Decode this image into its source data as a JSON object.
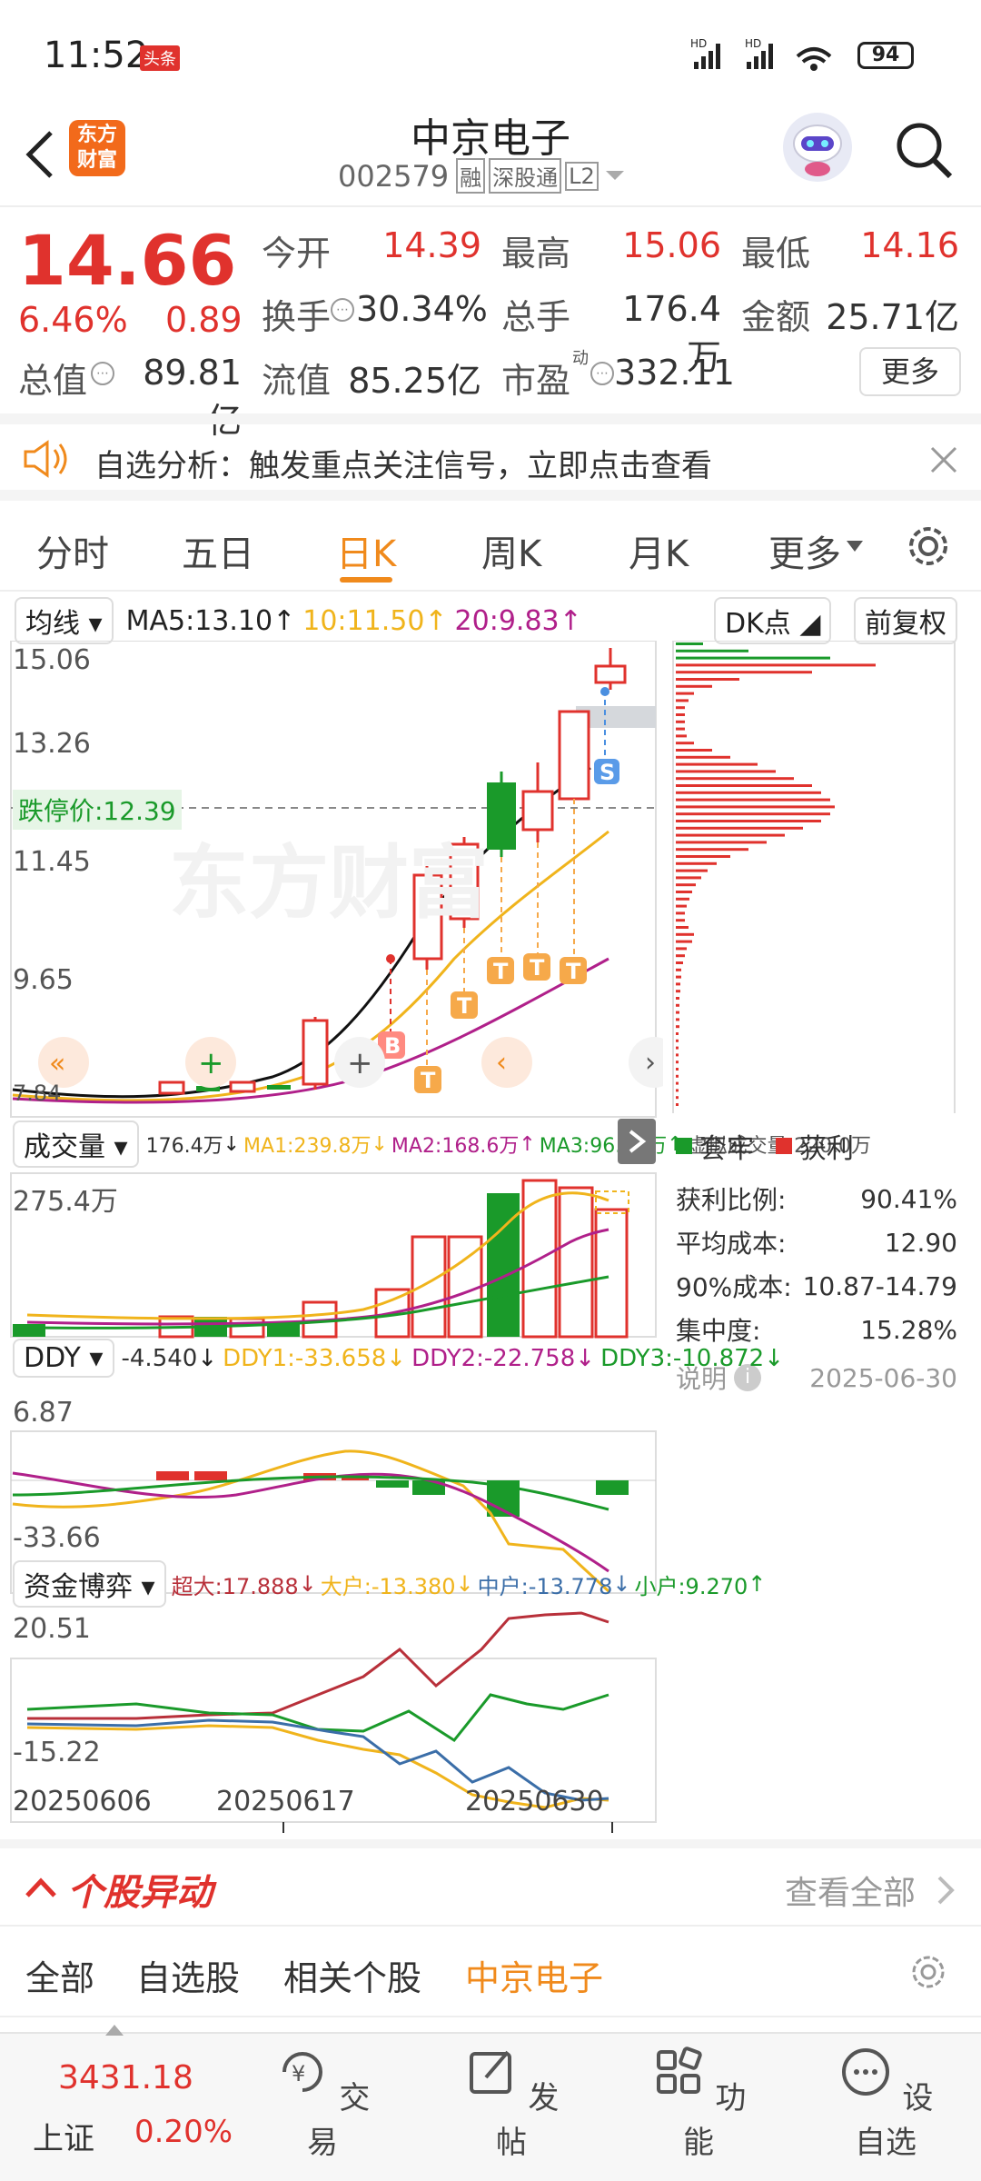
{
  "status_bar": {
    "time": "11:52",
    "app_badge": "头条",
    "battery": "94",
    "signal1": "HD",
    "signal2": "HD"
  },
  "header": {
    "title": "中京电子",
    "code": "002579",
    "tags": [
      "融",
      "深股通",
      "L2"
    ],
    "logo_text": "东方\n财富"
  },
  "quote": {
    "price": "14.66",
    "change_pct": "6.46%",
    "change": "0.89",
    "open_label": "今开",
    "open": "14.39",
    "high_label": "最高",
    "high": "15.06",
    "low_label": "最低",
    "low": "14.16",
    "turnover_label": "换手",
    "turnover": "30.34%",
    "volume_label": "总手",
    "volume": "176.4万",
    "amount_label": "金额",
    "amount": "25.71亿",
    "mcap_label": "总值",
    "mcap": "89.81亿",
    "float_label": "流值",
    "float": "85.25亿",
    "pe_label": "市盈",
    "pe_sup": "动",
    "pe": "332.11",
    "more_button": "更多"
  },
  "notice": {
    "text": "自选分析：触发重点关注信号，立即点击查看"
  },
  "tabs": [
    "分时",
    "五日",
    "日K",
    "周K",
    "月K",
    "更多"
  ],
  "active_tab": "日K",
  "kline": {
    "indicator_select": "均线",
    "ma5": "MA5:13.10",
    "ma10": "10:11.50",
    "ma20": "20:9.83",
    "dk_button": "DK点",
    "adjust_button": "前复权",
    "y_labels": [
      "15.06",
      "13.26",
      "11.45",
      "9.65",
      "7.84"
    ],
    "limit_label": "跌停价:12.39",
    "watermark": "东方财富",
    "markers": {
      "buy": "B",
      "sell": "S",
      "t": "T"
    }
  },
  "volume": {
    "select": "成交量",
    "summary": "176.4万",
    "ma1": "MA1:239.8万",
    "ma2": "MA2:168.6万",
    "ma3": "MA3:96.91万",
    "virtual": "虚拟成交量:220.0万",
    "y_label": "275.4万"
  },
  "ddy": {
    "select": "DDY",
    "value": "-4.540",
    "ddy1": "DDY1:-33.658",
    "ddy2": "DDY2:-22.758",
    "ddy3": "DDY3:-10.872",
    "y_top": "6.87",
    "y_bottom": "-33.66"
  },
  "fund": {
    "select": "资金博弈",
    "super": "超大:17.888",
    "big": "大户:-13.380",
    "mid": "中户:-13.778",
    "small": "小户:9.270",
    "y_top": "20.51",
    "y_bottom": "-15.22"
  },
  "dates": [
    "20250606",
    "20250617",
    "20250630"
  ],
  "chip": {
    "legend_trapped": "套牢",
    "legend_profit": "获利",
    "rows": [
      {
        "label": "获利比例:",
        "value": "90.41%"
      },
      {
        "label": "平均成本:",
        "value": "12.90"
      },
      {
        "label": "90%成本:",
        "value": "10.87-14.79"
      },
      {
        "label": "集中度:",
        "value": "15.28%"
      }
    ],
    "note_label": "说明",
    "note_date": "2025-06-30"
  },
  "movement": {
    "title": "个股异动",
    "view_all": "查看全部",
    "tabs": [
      "全部",
      "自选股",
      "相关个股",
      "中京电子"
    ],
    "active": "中京电子"
  },
  "bottom_nav": {
    "index_value": "3431.18",
    "index_name": "上证",
    "index_change": "0.20%",
    "items": [
      "交易",
      "发帖",
      "功能",
      "设自选"
    ]
  },
  "colors": {
    "up": "#e0322d",
    "down": "#1a9a2a",
    "accent": "#f08a1c",
    "ma5": "#111111",
    "ma10": "#f0b41c",
    "ma20": "#b0208a"
  }
}
